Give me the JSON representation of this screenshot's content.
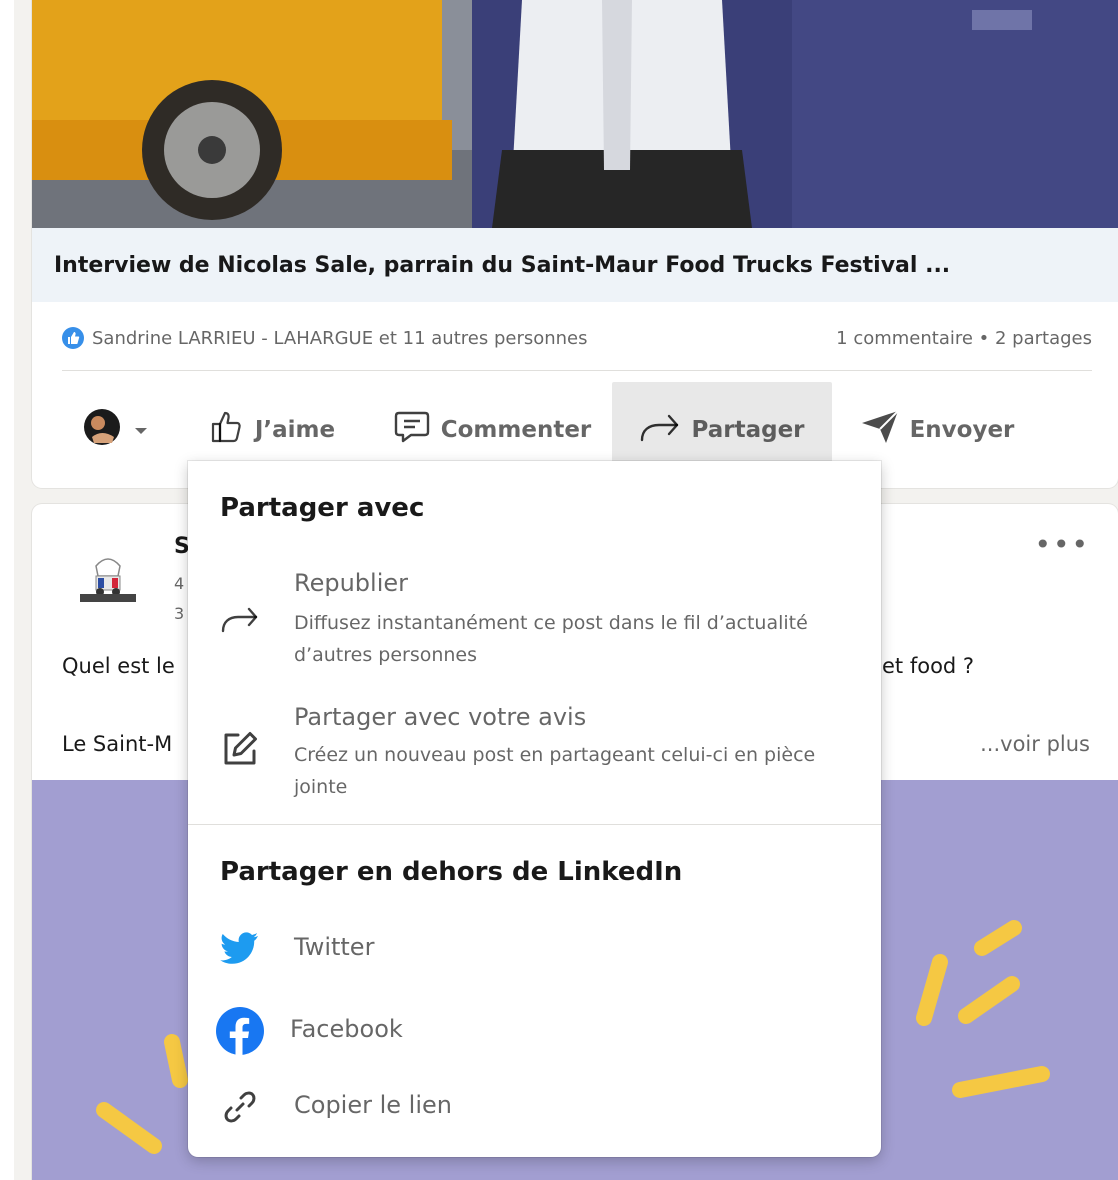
{
  "post1": {
    "link_title": "Interview de Nicolas Sale, parrain du Saint-Maur Food Trucks Festival ...",
    "reactions_text": "Sandrine LARRIEU - LAHARGUE et 11 autres personnes",
    "counts_text": "1 commentaire • 2 partages",
    "actions": {
      "like": "J’aime",
      "comment": "Commenter",
      "share": "Partager",
      "send": "Envoyer"
    }
  },
  "post2": {
    "author_initial": "S",
    "sub_line1": "4",
    "sub_line2": "3",
    "text_line1_start": "Quel est le",
    "text_line1_end": "et food ?",
    "text_line2_start": "Le Saint-M",
    "see_more": "...voir plus",
    "more_icon": "•••"
  },
  "share_menu": {
    "heading_share_with": "Partager avec",
    "repost_title": "Republier",
    "repost_desc": "Diffusez instantanément ce post dans le fil d’actualité d’autres personnes",
    "quote_title": "Partager avec votre avis",
    "quote_desc": "Créez un nouveau post en partageant celui-ci en pièce jointe",
    "heading_outside": "Partager en dehors de LinkedIn",
    "twitter": "Twitter",
    "facebook": "Facebook",
    "copy_link": "Copier le lien"
  },
  "colors": {
    "like_blue": "#378fe9",
    "twitter_blue": "#1d9bf0",
    "facebook_blue": "#1877f2",
    "post_image_purple": "#a29ed1",
    "accent_yellow": "#f5c843"
  }
}
